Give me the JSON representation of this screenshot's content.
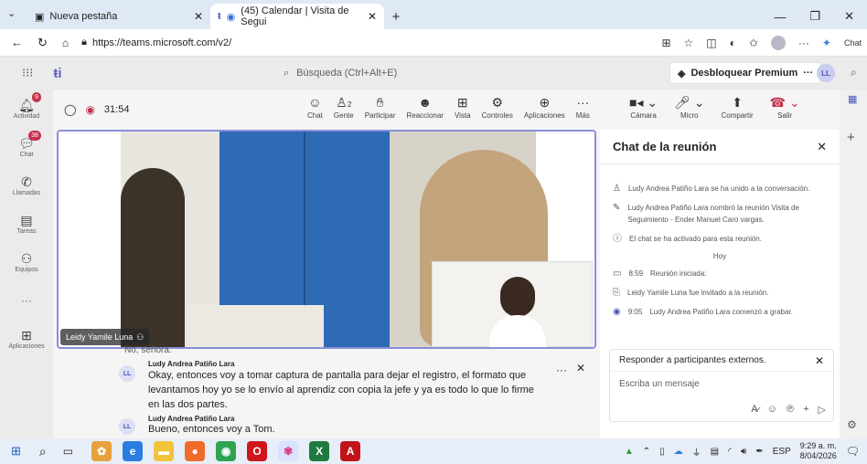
{
  "browser": {
    "tabs": [
      {
        "title": "Nueva pestaña"
      },
      {
        "title": "(45) Calendar | Visita de Segui"
      }
    ],
    "url": "https://teams.microsoft.com/v2/",
    "side_label": "Chat"
  },
  "teams": {
    "search_placeholder": "Búsqueda (Ctrl+Alt+E)",
    "premium_label": "Desbloquear Premium",
    "more": "···",
    "avatar_initials": "LL"
  },
  "rail": [
    {
      "label": "Actividad",
      "badge": "9"
    },
    {
      "label": "Chat",
      "badge": "38"
    },
    {
      "label": "Llamadas",
      "badge": ""
    },
    {
      "label": "Tareas",
      "badge": ""
    },
    {
      "label": "Equipos",
      "badge": ""
    },
    {
      "label": "···",
      "badge": ""
    },
    {
      "label": "Aplicaciones",
      "badge": ""
    }
  ],
  "meeting": {
    "timer": "31:54",
    "people_count": "2",
    "tools": [
      "Chat",
      "Gente",
      "Participar",
      "Reaccionar",
      "Vista",
      "Controles",
      "Aplicaciones",
      "Más"
    ],
    "camera": "Cámara",
    "mic": "Micro",
    "share": "Compartir",
    "leave": "Salir"
  },
  "stage": {
    "participant_name": "Leidy Yamile Luna"
  },
  "captions": {
    "partial_line": "No, señora.",
    "entries": [
      {
        "initials": "LL",
        "speaker": "Ludy Andrea Patiño Lara",
        "text": "Okay, entonces voy a tomar captura de pantalla para dejar el registro, el formato que levantamos hoy yo se lo envío al aprendiz con copia la jefe y ya es todo lo que lo firme en las dos partes."
      },
      {
        "initials": "LL",
        "speaker": "Ludy Andrea Patiño Lara",
        "text": "Bueno, entonces voy a Tom."
      }
    ],
    "more": "···"
  },
  "chat": {
    "title": "Chat de la reunión",
    "events": [
      {
        "icon": "person-joined-icon",
        "text": "Ludy Andrea Patiño Lara se ha unido a la conversación."
      },
      {
        "icon": "pencil-icon",
        "text": "Ludy Andrea Patiño Lara nombró la reunión Visita de Seguimiento - Ender Manuel Caro vargas."
      },
      {
        "icon": "info-icon",
        "text": "El chat se ha activado para esta reunión."
      }
    ],
    "day_label": "Hoy",
    "timeline": [
      {
        "icon": "video-icon",
        "time": "8:59",
        "text": "Reunión iniciada:"
      },
      {
        "icon": "invite-icon",
        "time": "",
        "text": "Leidy Yamile Luna fue invitado a la reunión."
      },
      {
        "icon": "record-icon",
        "time": "9:05",
        "text": "Ludy Andrea Patiño Lara comenzó a grabar."
      }
    ],
    "reply_label": "Responder a participantes externos.",
    "compose_placeholder": "Escriba un mensaje"
  },
  "taskbar": {
    "lang": "ESP",
    "time": "9:29 a. m.",
    "date": "8/04/2026"
  }
}
